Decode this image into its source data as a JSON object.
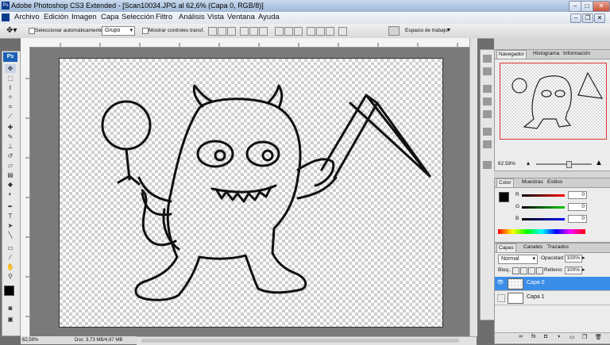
{
  "window": {
    "title": "Adobe Photoshop CS3 Extended - [Scan10034.JPG al 62,6% (Capa 0, RGB/8)]",
    "app_icon": "Ps"
  },
  "menu": [
    "Archivo",
    "Edición",
    "Imagen",
    "Capa",
    "Selección",
    "Filtro",
    "Análisis",
    "Vista",
    "Ventana",
    "Ayuda"
  ],
  "options": {
    "auto_select_label": "Seleccionar automáticamente:",
    "auto_select_value": "Grupo",
    "show_transform_label": "Mostrar controles transf.",
    "workspace_label": "Espacio de trabajo"
  },
  "status": {
    "zoom": "62,59%",
    "doc_info": "Doc: 3,73 MB/4,97 MB"
  },
  "navigator": {
    "tabs": [
      "Navegador",
      "Histograma",
      "Información"
    ],
    "zoom": "62.59%"
  },
  "color_panel": {
    "tabs": [
      "Color",
      "Muestras",
      "Estilos"
    ],
    "channels": [
      {
        "label": "R",
        "value": "0",
        "color": "#c00000"
      },
      {
        "label": "G",
        "value": "0",
        "color": "#00a000"
      },
      {
        "label": "B",
        "value": "0",
        "color": "#0000c0"
      }
    ]
  },
  "layers_panel": {
    "tabs": [
      "Capas",
      "Canales",
      "Trazados"
    ],
    "blend_mode": "Normal",
    "opacity_label": "Opacidad:",
    "opacity_value": "100%",
    "lock_label": "Bloq.:",
    "fill_label": "Relleno:",
    "fill_value": "100%",
    "layers": [
      {
        "name": "Capa 0",
        "selected": true
      },
      {
        "name": "Capa 1",
        "selected": false
      }
    ]
  },
  "colors": {
    "accent_selected": "#3b8ee8",
    "foreground": "#000000",
    "background": "#ffffff"
  }
}
